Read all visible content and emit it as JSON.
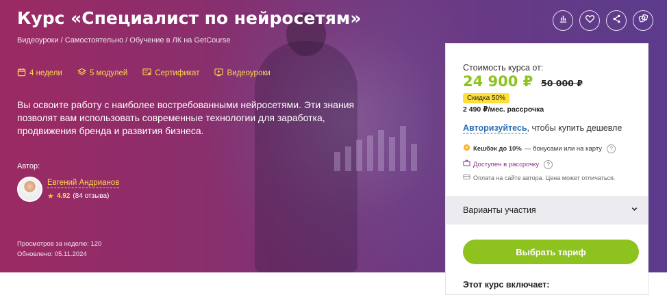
{
  "course": {
    "title": "Курс «Специалист по нейросетям»",
    "subtitle": "Видеоуроки / Самостоятельно / Обучение в ЛК на GetCourse",
    "features": [
      {
        "icon": "calendar-icon",
        "label": "4 недели"
      },
      {
        "icon": "layers-icon",
        "label": "5 модулей"
      },
      {
        "icon": "certificate-icon",
        "label": "Сертификат"
      },
      {
        "icon": "video-icon",
        "label": "Видеоуроки"
      }
    ],
    "description": "Вы освоите работу с наиболее востребованными нейросетями. Эти знания позволят вам использовать современные технологии для заработка, продвижения бренда и развития бизнеса.",
    "author_label": "Автор:",
    "author_name": "Евгений Андрианов",
    "rating_score": "4.92",
    "rating_reviews": "(84 отзыва)",
    "views": "Просмотров за неделю: 120",
    "updated": "Обновлено: 05.11.2024"
  },
  "actions": [
    {
      "icon": "compare-chart-icon"
    },
    {
      "icon": "heart-icon"
    },
    {
      "icon": "share-icon"
    },
    {
      "icon": "dice-icon"
    }
  ],
  "pricing": {
    "label": "Стоимость курса от:",
    "current": "24 900 ₽",
    "old": "50 000 ₽",
    "discount": "Скидка 50%",
    "installment": "2 490 ₽/мес. рассрочка",
    "auth_link": "Авторизуйтесь",
    "auth_rest": ", чтобы купить дешевле",
    "cashback_bold": "Кешбэк до 10%",
    "cashback_rest": " — бонусами или на карту",
    "installment_available": "Доступен в рассрочку",
    "payment_note": "Оплата на сайте автора. Цена может отличаться.",
    "variants_label": "Варианты участия",
    "choose_button": "Выбрать тариф",
    "includes_label": "Этот курс включает:"
  },
  "colors": {
    "accent_green": "#8dc21f",
    "accent_yellow": "#ffd84a",
    "hero_start": "#9b2a63",
    "hero_end": "#5b3b8c"
  }
}
